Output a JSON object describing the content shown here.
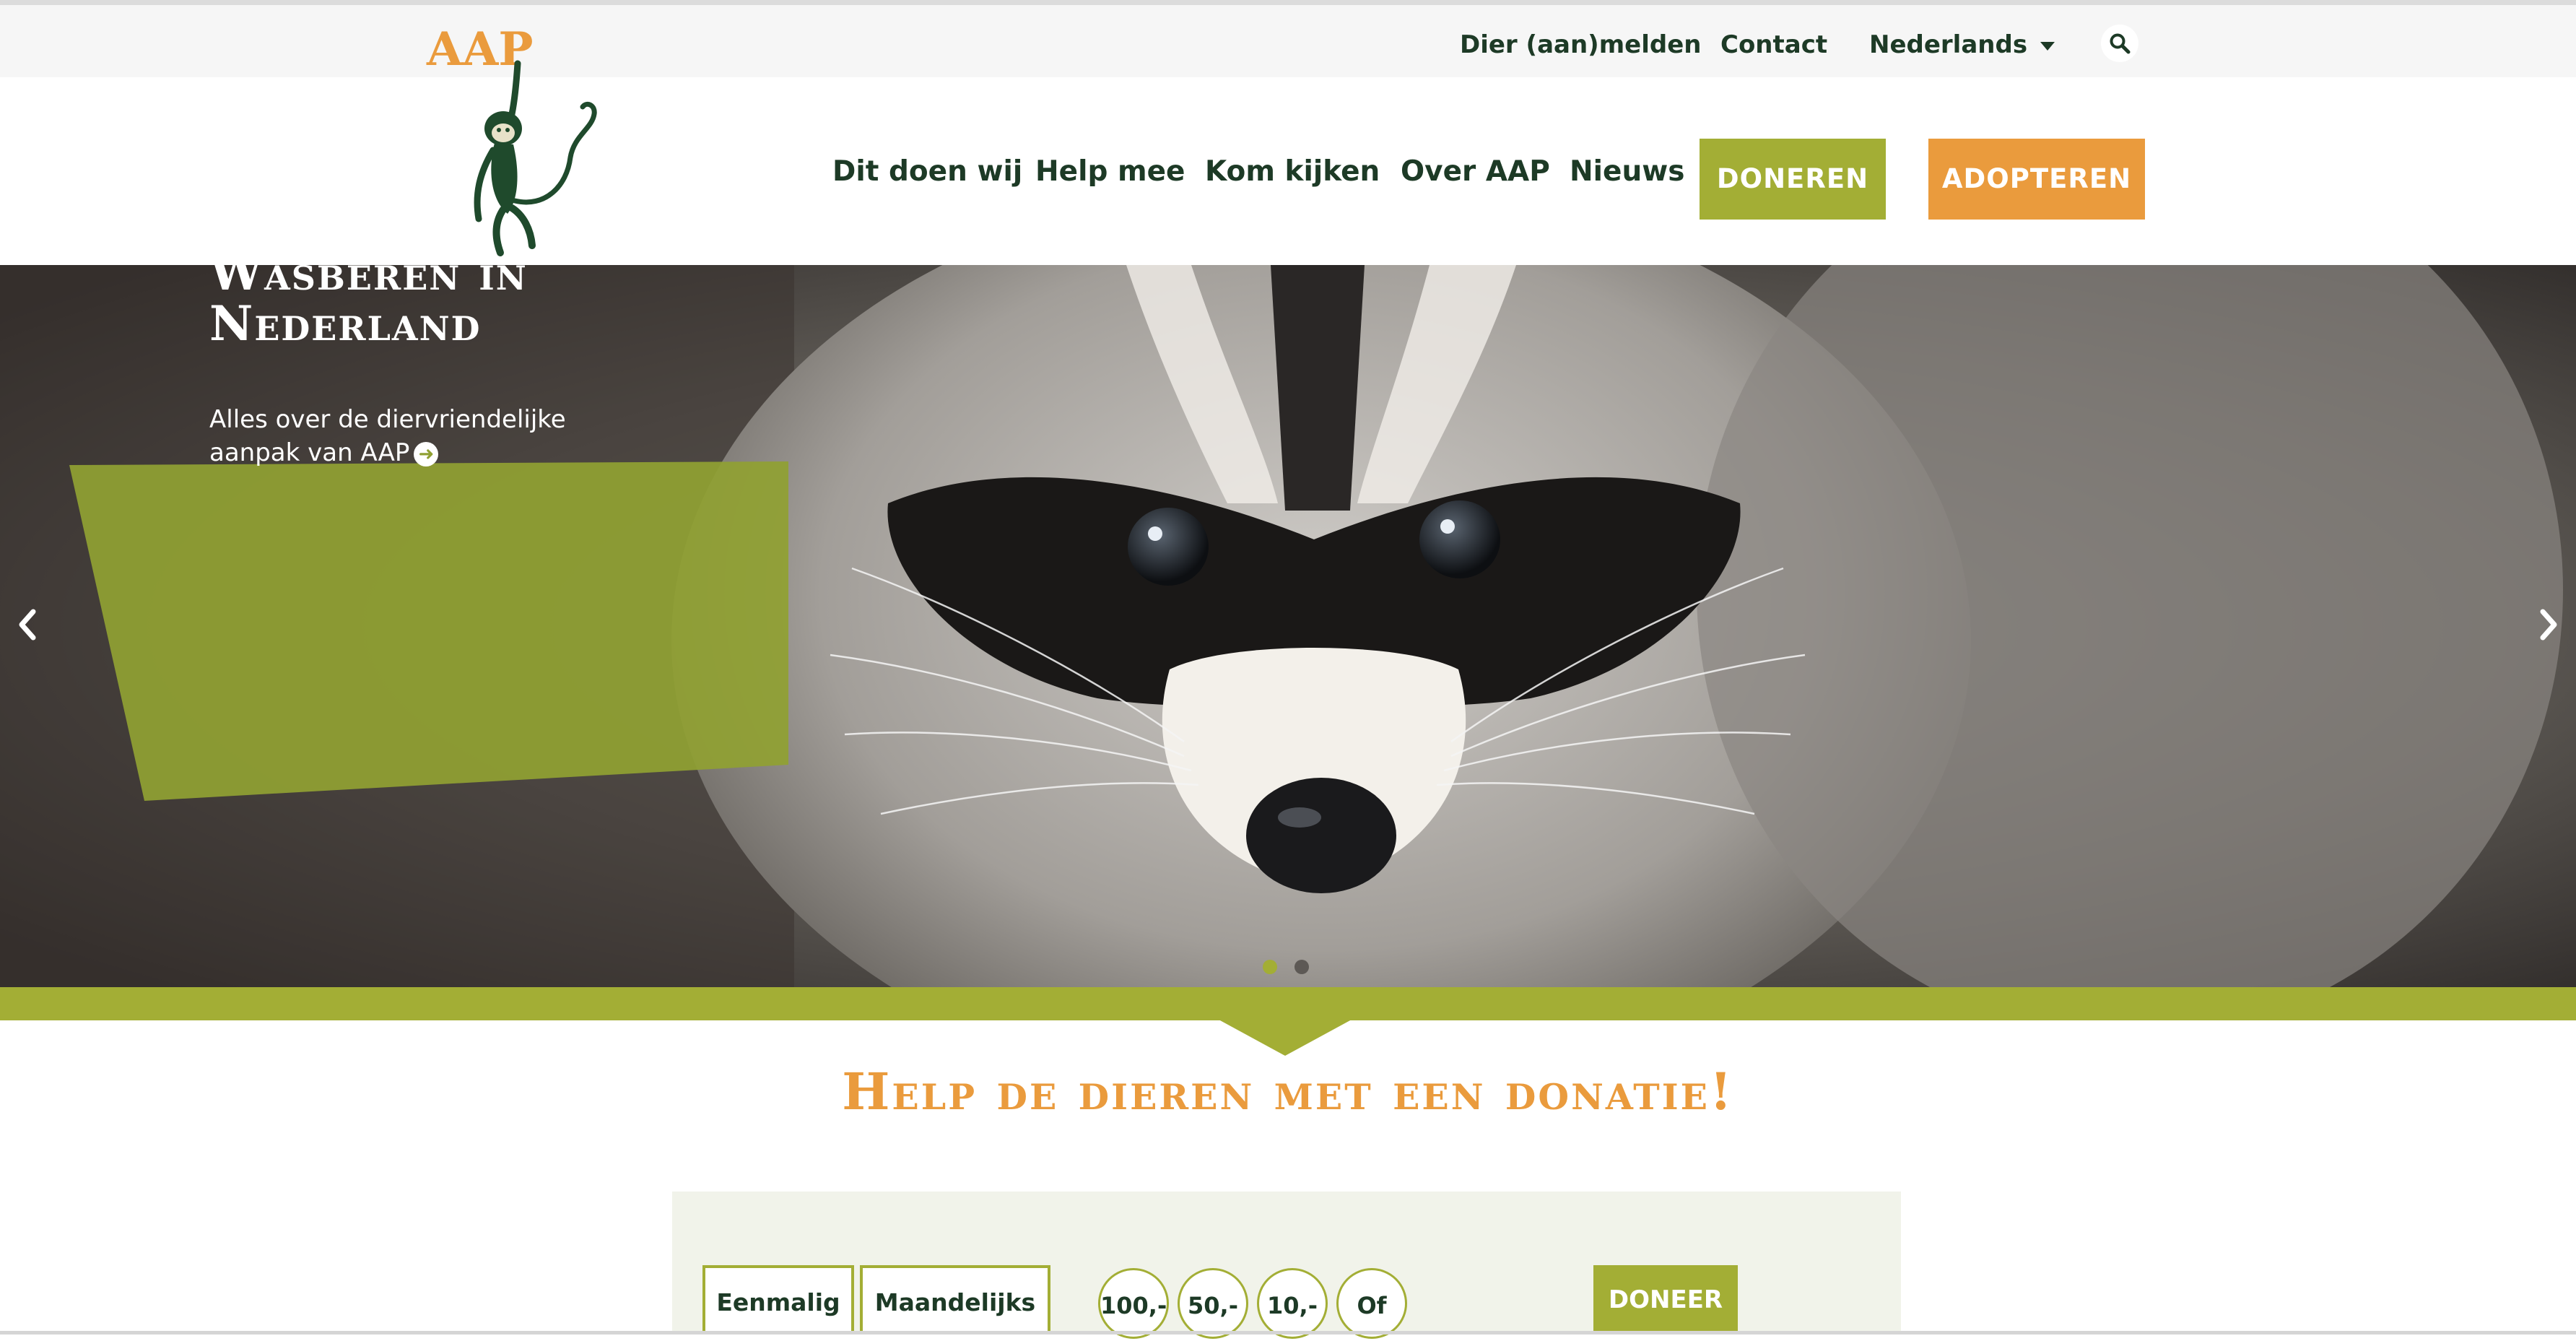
{
  "brand": {
    "logo_text": "AAP",
    "colors": {
      "green": "#a3ae35",
      "orange": "#ea9b3d",
      "dark_green": "#1d3a26"
    }
  },
  "utility_nav": {
    "report_animal": "Dier (aan)melden",
    "contact": "Contact",
    "language": "Nederlands",
    "search_icon": "search-icon"
  },
  "main_nav": {
    "items": [
      "Dit doen wij",
      "Help mee",
      "Kom kijken",
      "Over AAP",
      "Nieuws"
    ],
    "donate_button": "DONEREN",
    "adopt_button": "ADOPTEREN"
  },
  "hero": {
    "title": "Wasberen in Nederland",
    "subtitle": "Alles over de diervriendelijke aanpak van AAP",
    "link_icon": "arrow-circle-right-icon",
    "prev_icon": "chevron-left-icon",
    "next_icon": "chevron-right-icon",
    "slides_total": 2,
    "active_slide": 1
  },
  "donation": {
    "heading": "Help de dieren met een donatie!",
    "frequency_options": [
      "Eenmalig",
      "Maandelijks"
    ],
    "amounts": [
      "100,-",
      "50,-",
      "10,-",
      "Of"
    ],
    "submit_label": "DONEER"
  }
}
